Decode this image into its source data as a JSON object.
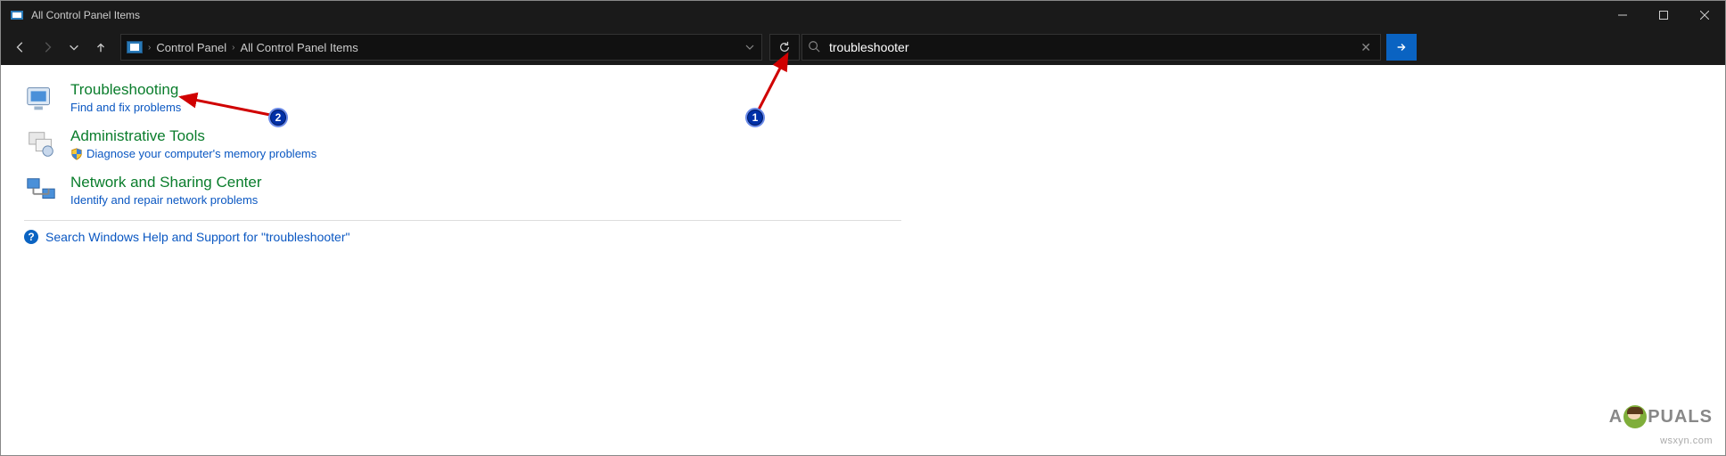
{
  "titlebar": {
    "title": "All Control Panel Items"
  },
  "breadcrumb": {
    "seg1": "Control Panel",
    "seg2": "All Control Panel Items"
  },
  "search": {
    "value": "troubleshooter"
  },
  "results": {
    "troubleshooting": {
      "title": "Troubleshooting",
      "sub": "Find and fix problems"
    },
    "admin": {
      "title": "Administrative Tools",
      "sub": "Diagnose your computer's memory problems"
    },
    "network": {
      "title": "Network and Sharing Center",
      "sub": "Identify and repair network problems"
    }
  },
  "help": {
    "text": "Search Windows Help and Support for \"troubleshooter\""
  },
  "annotations": {
    "n1": "1",
    "n2": "2"
  },
  "watermark": {
    "brand_pre": "A",
    "brand_post": "PUALS",
    "site": "wsxyn.com"
  }
}
